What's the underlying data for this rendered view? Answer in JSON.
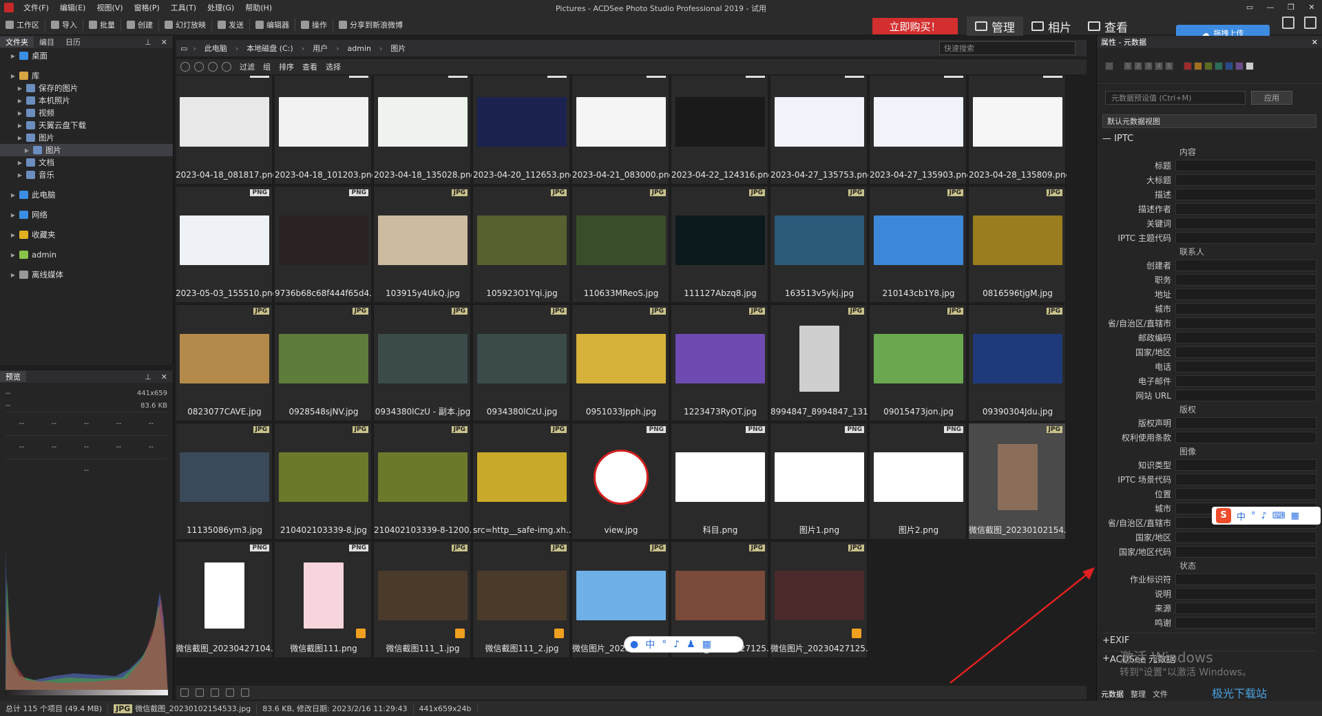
{
  "app": {
    "title": "Pictures - ACDSee Photo Studio Professional 2019 - 试用",
    "menu": [
      "文件(F)",
      "编辑(E)",
      "视图(V)",
      "窗格(P)",
      "工具(T)",
      "处理(G)",
      "帮助(H)"
    ],
    "window_controls": [
      "▭",
      "—",
      "❐",
      "✕"
    ]
  },
  "toolbar": {
    "items": [
      "工作区",
      "导入",
      "批量",
      "创建",
      "幻灯放映",
      "发送",
      "编辑器",
      "操作",
      "分享到新浪微博"
    ]
  },
  "buy_button": "立即购买！",
  "modes": [
    {
      "label": "管理",
      "active": true
    },
    {
      "label": "相片",
      "active": false
    },
    {
      "label": "查看",
      "active": false
    }
  ],
  "cloud_tip": "拖拽上传",
  "left_panel": {
    "tabs": [
      "文件夹",
      "编目",
      "日历"
    ],
    "tree": [
      {
        "label": "桌面",
        "indent": 1,
        "color": "#3a8ee6"
      },
      {
        "gap": true
      },
      {
        "label": "库",
        "indent": 1,
        "color": "#d9a441"
      },
      {
        "label": "保存的图片",
        "indent": 2,
        "color": "#6c8ebf"
      },
      {
        "label": "本机照片",
        "indent": 2,
        "color": "#6c8ebf"
      },
      {
        "label": "视频",
        "indent": 2,
        "color": "#6c8ebf"
      },
      {
        "label": "天翼云盘下载",
        "indent": 2,
        "color": "#6c8ebf"
      },
      {
        "label": "图片",
        "indent": 2,
        "color": "#6c8ebf"
      },
      {
        "label": "图片",
        "indent": 3,
        "color": "#6c8ebf",
        "selected": true
      },
      {
        "label": "文档",
        "indent": 2,
        "color": "#6c8ebf"
      },
      {
        "label": "音乐",
        "indent": 2,
        "color": "#6c8ebf"
      },
      {
        "gap": true
      },
      {
        "label": "此电脑",
        "indent": 1,
        "color": "#3a8ee6"
      },
      {
        "gap": true
      },
      {
        "label": "网络",
        "indent": 1,
        "color": "#3a8ee6"
      },
      {
        "gap": true
      },
      {
        "label": "收藏夹",
        "indent": 1,
        "color": "#e0b020"
      },
      {
        "gap": true
      },
      {
        "label": "admin",
        "indent": 1,
        "color": "#8bc34a"
      },
      {
        "gap": true
      },
      {
        "label": "离线媒体",
        "indent": 1,
        "color": "#999999"
      }
    ]
  },
  "preview_panel": {
    "title": "预览",
    "dims": "441x659",
    "size": "83.6 KB",
    "row1_left": "--",
    "row2_left": "--",
    "cells": [
      "--",
      "--",
      "--",
      "--",
      "--"
    ],
    "center": "--"
  },
  "address": {
    "crumbs": [
      "此电脑",
      "本地磁盘 (C:)",
      "用户",
      "admin",
      "图片"
    ],
    "search_placeholder": "快速搜索"
  },
  "filter_bar": [
    "过滤",
    "组",
    "排序",
    "查看",
    "选择"
  ],
  "thumbnails": [
    {
      "name": "2023-04-18_081817.png",
      "type": "PNG",
      "color": "#e8e8e8"
    },
    {
      "name": "2023-04-18_101203.png",
      "type": "PNG",
      "color": "#f2f2f2"
    },
    {
      "name": "2023-04-18_135028.png",
      "type": "PNG",
      "color": "#eef3ee"
    },
    {
      "name": "2023-04-20_112653.png",
      "type": "PNG",
      "color": "#1c2250"
    },
    {
      "name": "2023-04-21_083000.png",
      "type": "PNG",
      "color": "#f5f5f5"
    },
    {
      "name": "2023-04-22_124316.png",
      "type": "PNG",
      "color": "#1a1a1a"
    },
    {
      "name": "2023-04-27_135753.png",
      "type": "PNG",
      "color": "#f0f4fa"
    },
    {
      "name": "2023-04-27_135903.png",
      "type": "PNG",
      "color": "#f0f4fa"
    },
    {
      "name": "2023-04-28_135809.png",
      "type": "PNG",
      "color": "#f6f6f6"
    },
    {
      "name": "2023-05-03_155510.png",
      "type": "PNG",
      "color": "#eef2f6"
    },
    {
      "name": "9736b68c68f444f65d4...",
      "type": "PNG",
      "color": "#2b2321"
    },
    {
      "name": "103915y4UkQ.jpg",
      "type": "JPG",
      "color": "#cdbba0"
    },
    {
      "name": "105923O1Yqi.jpg",
      "type": "JPG",
      "color": "#56612f"
    },
    {
      "name": "110633MReoS.jpg",
      "type": "JPG",
      "color": "#3a4d2a"
    },
    {
      "name": "111127Abzq8.jpg",
      "type": "JPG",
      "color": "#0d1a1d"
    },
    {
      "name": "163513v5ykj.jpg",
      "type": "JPG",
      "color": "#2b5a7a"
    },
    {
      "name": "210143cb1Y8.jpg",
      "type": "JPG",
      "color": "#3d87d8"
    },
    {
      "name": "0816596tjgM.jpg",
      "type": "JPG",
      "color": "#9a7d1f"
    },
    {
      "name": "0823077CAVE.jpg",
      "type": "JPG",
      "color": "#b48a4a"
    },
    {
      "name": "0928548sjNV.jpg",
      "type": "JPG",
      "color": "#5e7c3a"
    },
    {
      "name": "0934380lCzU - 副本.jpg",
      "type": "JPG",
      "color": "#3a4b4a"
    },
    {
      "name": "0934380lCzU.jpg",
      "type": "JPG",
      "color": "#3a4b4a"
    },
    {
      "name": "0951033Jpph.jpg",
      "type": "JPG",
      "color": "#d6b23a"
    },
    {
      "name": "1223473RyOT.jpg",
      "type": "JPG",
      "color": "#6e4bb0"
    },
    {
      "name": "8994847_8994847_131...",
      "type": "JPG",
      "color": "#cfcfcf",
      "tall": true
    },
    {
      "name": "09015473jon.jpg",
      "type": "JPG",
      "color": "#6aa84f"
    },
    {
      "name": "09390304Jdu.jpg",
      "type": "JPG",
      "color": "#1f3a7a"
    },
    {
      "name": "11135086ym3.jpg",
      "type": "JPG",
      "color": "#3a4a5a"
    },
    {
      "name": "210402103339-8.jpg",
      "type": "JPG",
      "color": "#6a7a2a"
    },
    {
      "name": "210402103339-8-1200...",
      "type": "JPG",
      "color": "#6a7a2a"
    },
    {
      "name": "src=http__safe-img.xh...",
      "type": "JPG",
      "color": "#c8a92a"
    },
    {
      "name": "view.jpg",
      "type": "PNG",
      "color": "#ffffff",
      "stamp": true
    },
    {
      "name": "科目.png",
      "type": "PNG",
      "color": "#ffffff"
    },
    {
      "name": "图片1.png",
      "type": "PNG",
      "color": "#ffffff"
    },
    {
      "name": "图片2.png",
      "type": "PNG",
      "color": "#ffffff"
    },
    {
      "name": "微信截图_20230102154...",
      "type": "JPG",
      "color": "#8a6e5a",
      "tall": true,
      "selected": true
    },
    {
      "name": "微信截图_20230427104...",
      "type": "PNG",
      "color": "#ffffff",
      "tall": true
    },
    {
      "name": "微信截图111.png",
      "type": "PNG",
      "color": "#f7d5dc",
      "tall": true,
      "checked": true
    },
    {
      "name": "微信截图111_1.jpg",
      "type": "JPG",
      "color": "#4a3a2a",
      "checked": true
    },
    {
      "name": "微信截图111_2.jpg",
      "type": "JPG",
      "color": "#4a3a2a",
      "checked": true
    },
    {
      "name": "微信图片_20230317105...",
      "type": "JPG",
      "color": "#6fb0e8"
    },
    {
      "name": "微信图片_20230427125...",
      "type": "JPG",
      "color": "#7a4a3a"
    },
    {
      "name": "微信图片_20230427125...",
      "type": "JPG",
      "color": "#4a2a2a",
      "checked": true
    }
  ],
  "status": {
    "total": "总计 115 个项目 (49.4 MB)",
    "file_type": "JPG",
    "file_name": "微信截图_20230102154533.jpg",
    "file_info": "83.6 KB, 修改日期: 2023/2/16 11:29:43",
    "dims": "441x659x24b"
  },
  "right_panel": {
    "title": "属性 - 元数据",
    "rating_labels": [
      "1",
      "2",
      "3",
      "4",
      "5"
    ],
    "preset_placeholder": "元数据预设值 (Ctrl+M)",
    "apply": "应用",
    "view": "默认元数据视图",
    "section": "IPTC",
    "groups": [
      {
        "group": "内容",
        "fields": [
          "标题",
          "大标题",
          "描述",
          "描述作者",
          "关键词",
          "IPTC 主题代码"
        ]
      },
      {
        "group": "联系人",
        "fields": [
          "创建者",
          "职务",
          "地址",
          "城市",
          "省/自治区/直辖市",
          "邮政编码",
          "国家/地区",
          "电话",
          "电子邮件",
          "网站 URL"
        ]
      },
      {
        "group": "版权",
        "fields": [
          "版权声明",
          "权利使用条款"
        ]
      },
      {
        "group": "图像",
        "fields": [
          "知识类型",
          "IPTC 场景代码",
          "位置",
          "城市",
          "省/自治区/直辖市",
          "国家/地区",
          "国家/地区代码"
        ]
      },
      {
        "group": "状态",
        "fields": [
          "作业标识符",
          "说明",
          "来源",
          "鸣谢"
        ]
      }
    ],
    "collapsed": [
      "EXIF",
      "ACDSee 元数据"
    ],
    "tabs": [
      "元数据",
      "整理",
      "文件"
    ]
  },
  "watermark": {
    "line1": "激活 Windows",
    "line2": "转到\"设置\"以激活 Windows。"
  },
  "ime": {
    "zh": "中"
  },
  "site_logo": "极光下载站"
}
